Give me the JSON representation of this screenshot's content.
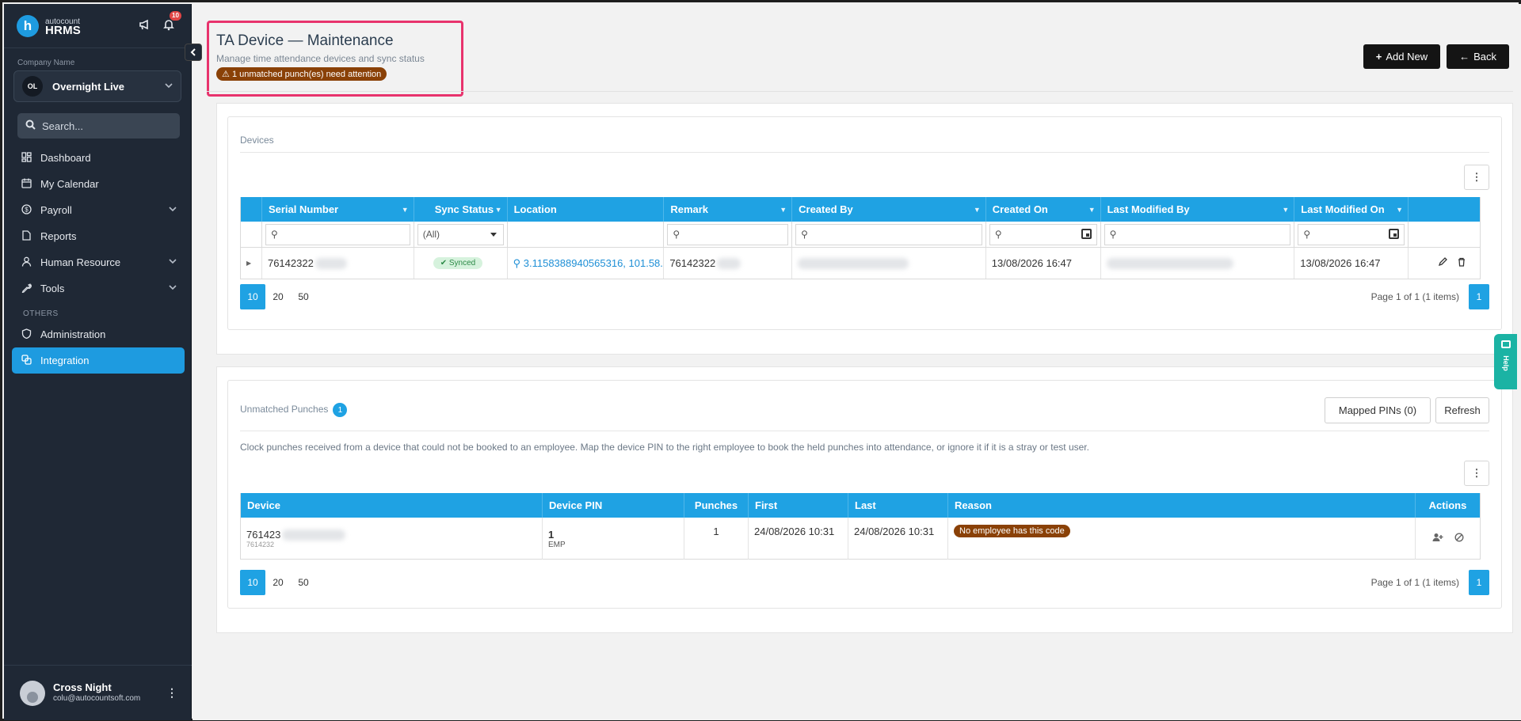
{
  "brand": {
    "small": "autocount",
    "name": "HRMS",
    "notification_count": "10"
  },
  "company": {
    "label": "Company Name",
    "initials": "OL",
    "name": "Overnight Live"
  },
  "search": {
    "placeholder": "Search..."
  },
  "nav": {
    "items": [
      {
        "label": "Dashboard",
        "icon": "dashboard-icon"
      },
      {
        "label": "My Calendar",
        "icon": "calendar-icon"
      },
      {
        "label": "Payroll",
        "icon": "payroll-icon"
      },
      {
        "label": "Reports",
        "icon": "reports-icon"
      },
      {
        "label": "Human Resource",
        "icon": "user-icon"
      },
      {
        "label": "Tools",
        "icon": "wrench-icon"
      }
    ],
    "others_label": "OTHERS",
    "others": [
      {
        "label": "Administration",
        "icon": "shield-icon"
      },
      {
        "label": "Integration",
        "icon": "integration-icon"
      }
    ]
  },
  "user": {
    "name": "Cross Night",
    "email": "colu@autocountsoft.com"
  },
  "header": {
    "title": "TA Device — Maintenance",
    "subtitle": "Manage time attendance devices and sync status",
    "attention": "1 unmatched punch(es) need attention",
    "add_new": "Add New",
    "back": "Back"
  },
  "devices": {
    "title": "Devices",
    "columns": [
      "Serial Number",
      "Sync Status",
      "Location",
      "Remark",
      "Created By",
      "Created On",
      "Last Modified By",
      "Last Modified On"
    ],
    "sync_filter": "(All)",
    "row": {
      "serial": "76142322",
      "sync": "Synced",
      "location": "3.1158388940565316, 101.58...",
      "remark": "76142322",
      "created_on": "13/08/2026 16:47",
      "modified_on": "13/08/2026 16:47"
    },
    "page_sizes": [
      "10",
      "20",
      "50"
    ],
    "page_info": "Page 1 of 1 (1 items)",
    "page": "1"
  },
  "unmatched": {
    "title": "Unmatched Punches",
    "count": "1",
    "mapped_pins": "Mapped PINs (0)",
    "refresh": "Refresh",
    "description": "Clock punches received from a device that could not be booked to an employee. Map the device PIN to the right employee to book the held punches into attendance, or ignore it if it is a stray or test user.",
    "columns": [
      "Device",
      "Device PIN",
      "Punches",
      "First",
      "Last",
      "Reason",
      "Actions"
    ],
    "row": {
      "device": "761423",
      "device_sub": "7614232",
      "pin": "1",
      "pin_sub": "EMP",
      "punches": "1",
      "first": "24/08/2026 10:31",
      "last": "24/08/2026 10:31",
      "reason": "No employee has this code"
    },
    "page_sizes": [
      "10",
      "20",
      "50"
    ],
    "page_info": "Page 1 of 1 (1 items)",
    "page": "1"
  },
  "help_label": "Help"
}
